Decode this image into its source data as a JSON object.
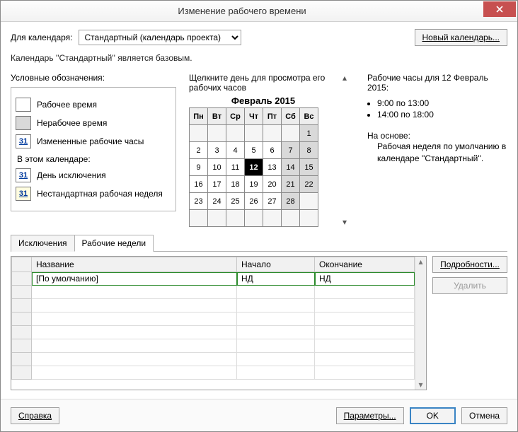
{
  "window": {
    "title": "Изменение рабочего времени"
  },
  "for_calendar_label": "Для календаря:",
  "calendar_select": {
    "value": "Стандартный (календарь проекта)"
  },
  "new_calendar_btn": "Новый календарь...",
  "base_text": "Календарь ''Стандартный'' является базовым.",
  "legend": {
    "title": "Условные обозначения:",
    "working": "Рабочее время",
    "nonworking": "Нерабочее время",
    "changed": "Измененные рабочие часы",
    "in_this_cal": "В этом календаре:",
    "exc_day": "День исключения",
    "nonstd_week": "Нестандартная рабочая неделя",
    "num": "31"
  },
  "calendar": {
    "instruction": "Щелкните день для просмотра его рабочих часов",
    "month": "Февраль 2015",
    "dow": [
      "Пн",
      "Вт",
      "Ср",
      "Чт",
      "Пт",
      "Сб",
      "Вс"
    ],
    "weeks": [
      [
        {
          "d": "",
          "t": "e"
        },
        {
          "d": "",
          "t": "e"
        },
        {
          "d": "",
          "t": "e"
        },
        {
          "d": "",
          "t": "e"
        },
        {
          "d": "",
          "t": "e"
        },
        {
          "d": "",
          "t": "e"
        },
        {
          "d": "1",
          "t": "we"
        }
      ],
      [
        {
          "d": "2"
        },
        {
          "d": "3"
        },
        {
          "d": "4"
        },
        {
          "d": "5"
        },
        {
          "d": "6"
        },
        {
          "d": "7",
          "t": "we"
        },
        {
          "d": "8",
          "t": "we"
        }
      ],
      [
        {
          "d": "9"
        },
        {
          "d": "10"
        },
        {
          "d": "11"
        },
        {
          "d": "12",
          "t": "sel"
        },
        {
          "d": "13"
        },
        {
          "d": "14",
          "t": "we"
        },
        {
          "d": "15",
          "t": "we"
        }
      ],
      [
        {
          "d": "16"
        },
        {
          "d": "17"
        },
        {
          "d": "18"
        },
        {
          "d": "19"
        },
        {
          "d": "20"
        },
        {
          "d": "21",
          "t": "we"
        },
        {
          "d": "22",
          "t": "we"
        }
      ],
      [
        {
          "d": "23"
        },
        {
          "d": "24"
        },
        {
          "d": "25"
        },
        {
          "d": "26"
        },
        {
          "d": "27"
        },
        {
          "d": "28",
          "t": "we"
        },
        {
          "d": "",
          "t": "e"
        }
      ],
      [
        {
          "d": "",
          "t": "e"
        },
        {
          "d": "",
          "t": "e"
        },
        {
          "d": "",
          "t": "e"
        },
        {
          "d": "",
          "t": "e"
        },
        {
          "d": "",
          "t": "e"
        },
        {
          "d": "",
          "t": "e"
        },
        {
          "d": "",
          "t": "e"
        }
      ]
    ]
  },
  "info": {
    "heading": "Рабочие часы для 12 Февраль 2015:",
    "hours": [
      "9:00 по 13:00",
      "14:00 по 18:00"
    ],
    "based_label": "На основе:",
    "based_text": "Рабочая неделя по умолчанию в календаре ''Стандартный''."
  },
  "tabs": {
    "exceptions": "Исключения",
    "workweeks": "Рабочие недели"
  },
  "grid": {
    "cols": {
      "name": "Название",
      "start": "Начало",
      "end": "Окончание"
    },
    "rows": [
      {
        "name": "[По умолчанию]",
        "start": "НД",
        "end": "НД"
      }
    ]
  },
  "side": {
    "details": "Подробности...",
    "delete": "Удалить"
  },
  "footer": {
    "help": "Справка",
    "options": "Параметры...",
    "ok": "OK",
    "cancel": "Отмена"
  }
}
